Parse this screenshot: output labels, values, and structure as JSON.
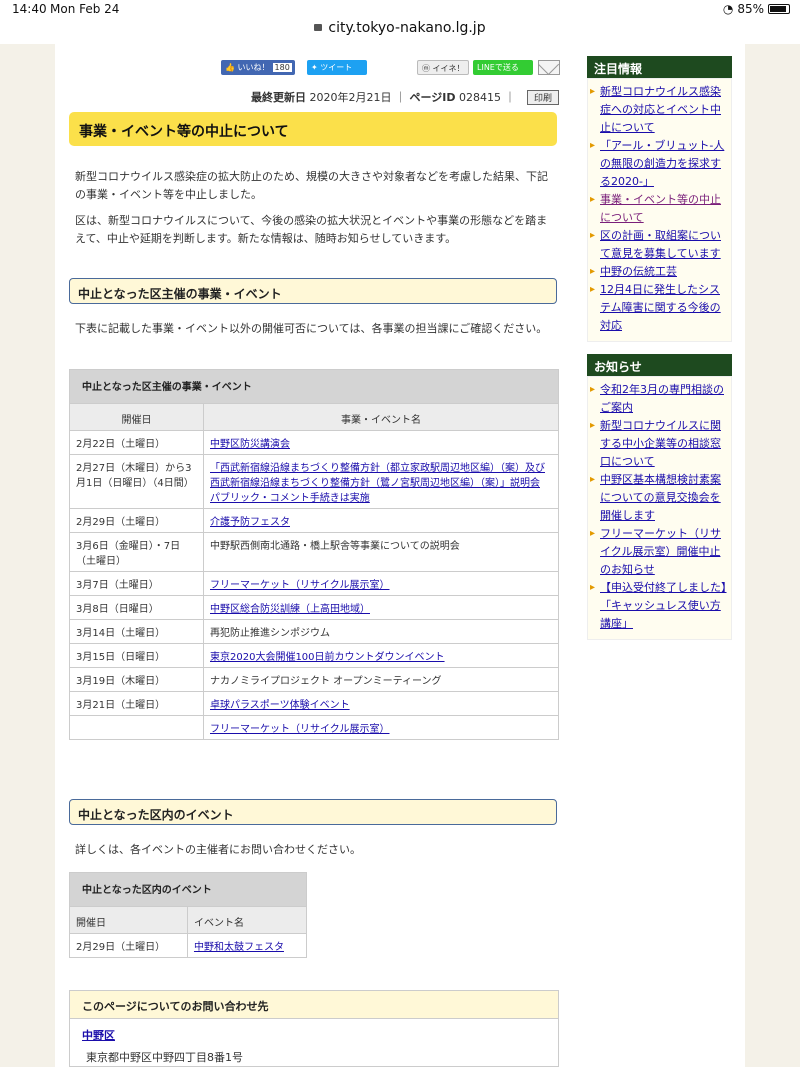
{
  "status_bar": {
    "time": "14:40",
    "date": "Mon Feb 24",
    "battery": "85%"
  },
  "url": "city.tokyo-nakano.lg.jp",
  "share": {
    "facebook_label": "いいね！",
    "facebook_count": "180",
    "twitter_label": "ツイート",
    "mixi_label": "イイネ！",
    "line_label": "LINEで送る"
  },
  "meta": {
    "updated_label": "最終更新日",
    "updated_date": "2020年2月21日",
    "page_id_label": "ページID",
    "page_id": "028415",
    "print_label": "印刷"
  },
  "title": "事業・イベント等の中止について",
  "intro": [
    "新型コロナウイルス感染症の拡大防止のため、規模の大きさや対象者などを考慮した結果、下記の事業・イベント等を中止しました。",
    "区は、新型コロナウイルスについて、今後の感染の拡大状況とイベントや事業の形態などを踏まえて、中止や延期を判断します。新たな情報は、随時お知らせしていきます。"
  ],
  "section1": {
    "heading": "中止となった区主催の事業・イベント",
    "note": "下表に記載した事業・イベント以外の開催可否については、各事業の担当課にご確認ください。",
    "table": {
      "caption": "中止となった区主催の事業・イベント",
      "col_date": "開催日",
      "col_name": "事業・イベント名",
      "rows": [
        {
          "date": "2月22日（土曜日）",
          "name": "中野区防災講演会",
          "link": true
        },
        {
          "date": "2月27日（木曜日）から3月1日（日曜日）（4日間）",
          "name": "「西武新宿線沿線まちづくり整備方針（都立家政駅周辺地区編）（案）及び西武新宿線沿線まちづくり整備方針（鷺ノ宮駅周辺地区編）（案）」説明会 パブリック・コメント手続きは実施",
          "link": true
        },
        {
          "date": "2月29日（土曜日）",
          "name": "介護予防フェスタ",
          "link": true
        },
        {
          "date": "3月6日（金曜日）・7日（土曜日）",
          "name": "中野駅西側南北通路・橋上駅舎等事業についての説明会",
          "link": false
        },
        {
          "date": "3月7日（土曜日）",
          "name": "フリーマーケット（リサイクル展示室）",
          "link": true
        },
        {
          "date": "3月8日（日曜日）",
          "name": "中野区総合防災訓練（上高田地域）",
          "link": true
        },
        {
          "date": "3月14日（土曜日）",
          "name": "再犯防止推進シンポジウム",
          "link": false
        },
        {
          "date": "3月15日（日曜日）",
          "name": "東京2020大会開催100日前カウントダウンイベント",
          "link": true
        },
        {
          "date": "3月19日（木曜日）",
          "name": "ナカノミライプロジェクト オープンミーティーング",
          "link": false
        },
        {
          "date": "3月21日（土曜日）",
          "name": "卓球パラスポーツ体験イベント",
          "link": true
        },
        {
          "date": "",
          "name": "フリーマーケット（リサイクル展示室）",
          "link": true
        }
      ]
    }
  },
  "section2": {
    "heading": "中止となった区内のイベント",
    "note": "詳しくは、各イベントの主催者にお問い合わせください。",
    "table": {
      "caption": "中止となった区内のイベント",
      "col_date": "開催日",
      "col_name": "イベント名",
      "rows": [
        {
          "date": "2月29日（土曜日）",
          "name": "中野和太鼓フェスタ"
        }
      ]
    }
  },
  "contact": {
    "heading": "このページについてのお問い合わせ先",
    "name": "中野区",
    "address": "東京都中野区中野四丁目8番1号"
  },
  "sidebar": {
    "featured_heading": "注目情報",
    "featured": [
      "新型コロナウイルス感染症への対応とイベント中止について",
      "「アール・ブリュット-人の無限の創造力を探求する2020-」",
      "事業・イベント等の中止について",
      "区の計画・取組案について意見を募集しています",
      "中野の伝統工芸",
      "12月4日に発生したシステム障害に関する今後の対応"
    ],
    "news_heading": "お知らせ",
    "news": [
      "令和2年3月の専門相談のご案内",
      "新型コロナウイルスに関する中小企業等の相談窓口について",
      "中野区基本構想検討素案についての意見交換会を開催します",
      "フリーマーケット（リサイクル展示室）開催中止のお知らせ",
      "【申込受付終了しました】「キャッシュレス使い方講座」"
    ]
  }
}
